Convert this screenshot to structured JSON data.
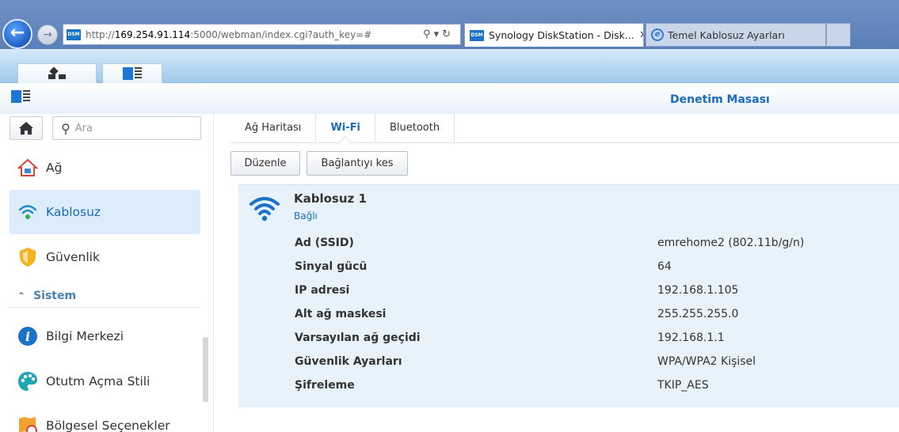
{
  "browser": {
    "url_prefix": "http://",
    "url_host": "169.254.91.114",
    "url_rest": ":5000/webman/index.cgi?auth_key=#",
    "favicon_text": "DSM",
    "tabs": [
      {
        "label": "Synology DiskStation - Disk...",
        "active": true
      },
      {
        "label": "Temel Kablosuz Ayarları",
        "active": false
      }
    ]
  },
  "window": {
    "title": "Denetim Masası"
  },
  "sidebar": {
    "search_placeholder": "Ara",
    "items": [
      {
        "label": "Ağ"
      },
      {
        "label": "Kablosuz"
      },
      {
        "label": "Güvenlik"
      }
    ],
    "section": {
      "label": "Sistem"
    },
    "system_items": [
      {
        "label": "Bilgi Merkezi"
      },
      {
        "label": "Otutm Açma Stili"
      },
      {
        "label": "Bölgesel Seçenekler"
      }
    ]
  },
  "main": {
    "tabs": [
      {
        "label": "Ağ Haritası"
      },
      {
        "label": "Wi-Fi"
      },
      {
        "label": "Bluetooth"
      }
    ],
    "buttons": {
      "edit": "Düzenle",
      "disconnect": "Bağlantıyı kes"
    },
    "connection": {
      "name": "Kablosuz 1",
      "status": "Bağlı",
      "rows": [
        {
          "label": "Ad (SSID)",
          "value": "emrehome2 (802.11b/g/n)"
        },
        {
          "label": "Sinyal gücü",
          "value": "64"
        },
        {
          "label": "IP adresi",
          "value": "192.168.1.105"
        },
        {
          "label": "Alt ağ maskesi",
          "value": "255.255.255.0"
        },
        {
          "label": "Varsayılan ağ geçidi",
          "value": "192.168.1.1"
        },
        {
          "label": "Güvenlik Ayarları",
          "value": "WPA/WPA2 Kişisel"
        },
        {
          "label": "Şifreleme",
          "value": "TKIP_AES"
        }
      ]
    }
  },
  "colors": {
    "accent": "#1a6bbd",
    "selected_bg": "#dcecfa",
    "panel_bg": "#e7f2fb"
  }
}
